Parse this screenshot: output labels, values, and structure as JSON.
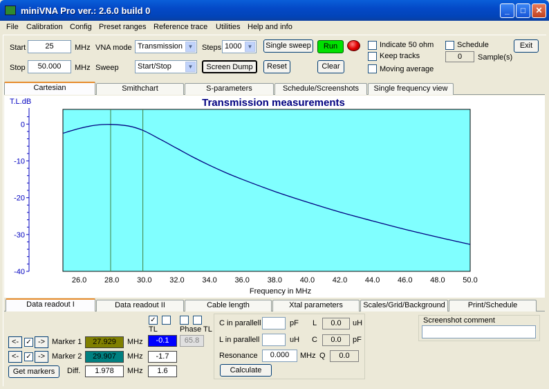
{
  "window": {
    "title": "miniVNA Pro ver.: 2.6.0 build 0",
    "minimize_glyph": "_",
    "maximize_glyph": "□",
    "close_glyph": "✕"
  },
  "menu": [
    "File",
    "Calibration",
    "Config",
    "Preset ranges",
    "Reference trace",
    "Utilities",
    "Help and info"
  ],
  "controls": {
    "start_label": "Start",
    "start_value": "25",
    "start_unit": "MHz",
    "stop_label": "Stop",
    "stop_value": "50.000",
    "stop_unit": "MHz",
    "vna_mode_label": "VNA mode",
    "vna_mode_value": "Transmission",
    "sweep_label": "Sweep",
    "sweep_value": "Start/Stop",
    "steps_label": "Steps",
    "steps_value": "1000",
    "single_sweep": "Single sweep",
    "run": "Run",
    "screen_dump": "Screen Dump",
    "reset": "Reset",
    "clear": "Clear",
    "indicate_50": "Indicate 50 ohm",
    "keep_tracks": "Keep tracks",
    "moving_average": "Moving average",
    "schedule": "Schedule",
    "samples_value": "0",
    "samples_label": "Sample(s)",
    "exit": "Exit"
  },
  "top_tabs": [
    "Cartesian",
    "Smithchart",
    "S-parameters",
    "Schedule/Screenshots",
    "Single frequency view"
  ],
  "bottom_tabs": [
    "Data readout I",
    "Data readout II",
    "Cable length",
    "Xtal parameters",
    "Scales/Grid/Background",
    "Print/Schedule"
  ],
  "chart_data": {
    "type": "line",
    "title": "Transmission measurements",
    "ylabel": "T.L.dB",
    "xlabel": "Frequency in MHz",
    "xlim": [
      25,
      50
    ],
    "ylim": [
      -40,
      4
    ],
    "x_ticks": [
      "26.0",
      "28.0",
      "30.0",
      "32.0",
      "34.0",
      "36.0",
      "38.0",
      "40.0",
      "42.0",
      "44.0",
      "46.0",
      "48.0",
      "50.0"
    ],
    "y_ticks": [
      "0",
      "-10",
      "-20",
      "-30",
      "-40"
    ],
    "x": [
      25,
      26,
      27,
      27.929,
      29,
      29.907,
      31,
      32,
      33,
      34,
      35,
      36,
      38,
      40,
      42,
      44,
      46,
      48,
      50
    ],
    "y": [
      -2.5,
      -1.2,
      -0.3,
      -0.1,
      -0.5,
      -1.7,
      -4.2,
      -6.6,
      -9.0,
      -11.2,
      -13.2,
      -15.0,
      -18.3,
      -21.2,
      -23.9,
      -26.3,
      -28.6,
      -30.7,
      -32.7
    ],
    "markers": [
      27.929,
      29.907
    ],
    "background": "#80ffff",
    "line_color": "#000080",
    "marker_color": "#408040"
  },
  "readout": {
    "tl_header": "TL",
    "phase_header": "Phase TL",
    "marker1_label": "Marker 1",
    "marker1_freq": "27.929",
    "marker1_tl": "-0.1",
    "marker1_phase": "65.8",
    "marker2_label": "Marker 2",
    "marker2_freq": "29.907",
    "marker2_tl": "-1.7",
    "get_markers": "Get markers",
    "diff_label": "Diff.",
    "diff_freq": "1.978",
    "diff_tl": "1.6",
    "mhz": "MHz",
    "left_glyph": "<-",
    "right_glyph": "->",
    "check_glyph": "✓"
  },
  "lc": {
    "c_parallel": "C in parallell",
    "c_unit": "pF",
    "l_parallel": "L in parallell",
    "l_unit": "uH",
    "resonance": "Resonance",
    "resonance_value": "0.000",
    "resonance_unit": "MHz",
    "l_label": "L",
    "l_value": "0.0",
    "l_value_unit": "uH",
    "c_label": "C",
    "c_value": "0.0",
    "c_value_unit": "pF",
    "q_label": "Q",
    "q_value": "0.0",
    "calculate": "Calculate"
  },
  "screenshot": {
    "label": "Screenshot  comment"
  }
}
